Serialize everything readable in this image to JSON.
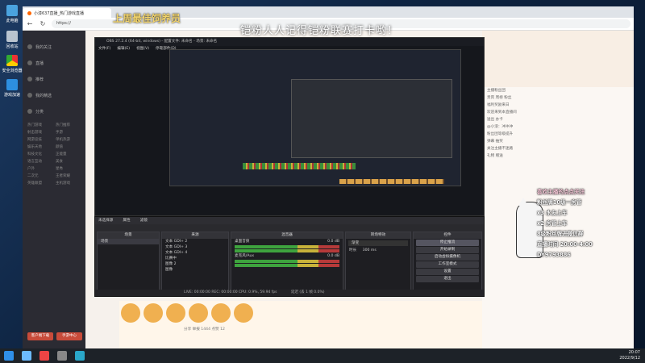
{
  "desktop": {
    "icons": [
      "此电脑",
      "回收站",
      "安全浏览器",
      "游戏加速"
    ]
  },
  "browser": {
    "tab_title": "小漆637直播_热门游戏直播",
    "url": "https://"
  },
  "overlay": {
    "banner": "上周最佳饲养员",
    "headline": "铠粉人人记得铠粉联赛打卡哟！"
  },
  "site": {
    "sidebar_items": [
      "我的关注",
      "直播",
      "推荐",
      "我的精选",
      "分类"
    ],
    "sidebar_grid": [
      "热门游戏",
      "热门推荐",
      "射击游戏",
      "手游",
      "网游竞技",
      "单机热游",
      "娱乐天地",
      "颜值",
      "科技文化",
      "正能量",
      "语言互动",
      "美食",
      "户外",
      "星秀",
      "二次元",
      "王者荣耀",
      "英雄联盟",
      "主机游戏"
    ],
    "sidebar_buttons": [
      "客户端下载",
      "手游中心"
    ],
    "chat_lines": [
      "主播粉丝团",
      "贵宾 周榜 粉丝",
      "福利奖励来日",
      "欢迎来到本直播间",
      "送出 办卡",
      "@小漆：冲冲冲",
      "粉丝团等级提升",
      "弹幕 抽奖",
      "关注主播不迷路",
      "礼物 赠送"
    ],
    "bottom_bar": "分享  举报  1444  点赞 12"
  },
  "obs": {
    "menu": [
      "文件(F)",
      "编辑(E)",
      "视图(V)",
      "停靠部件(D)"
    ],
    "title": "OBS 27.2.4 (64-bit, windows) - 配置文件: 未命名 - 场景: 未命名",
    "scene_header": "场景",
    "scene_item": "场景",
    "sources_header": "来源",
    "sources": [
      "文本 GDI+ 2",
      "文本 GDI+ 3",
      "文本 GDI+ 4",
      "比赛中",
      "图像 2",
      "图像"
    ],
    "mixer_header": "混音器",
    "mixer_tracks": [
      "桌面音频",
      "麦克风/Aux"
    ],
    "mixer_levels": [
      "0.0 dB",
      "0.0 dB"
    ],
    "transition_header": "转场特效",
    "transition_mode": "渐变",
    "duration_label": "时长",
    "duration_value": "300 ms",
    "controls_header": "控件",
    "controls": [
      "停止推流",
      "开始录制",
      "启动虚拟摄像机",
      "工作室模式",
      "设置",
      "退出"
    ],
    "no_source": "未选择源",
    "properties_label": "属性",
    "filters_label": "滤镜",
    "status": "LIVE: 00:00:00   REC: 00:00:00   CPU: 0.9%, 59.94 fps",
    "delay_status": "延迟 (丢 1 帧 0.0%)"
  },
  "info_box": {
    "line1": "喜欢主播的点点关注",
    "line2": "粉丝牌10级一房管",
    "line3": "x3 水友上车",
    "line4": "x2 房管上车",
    "line5": "8级粉丝牌进微信群",
    "line6": "直播时间 20:00-4:00",
    "line7": "DY9793886"
  },
  "taskbar": {
    "time": "20:07",
    "date": "2022/9/12"
  },
  "colors": {
    "banner": "#f1d36b",
    "obs_bg": "#2a2a2e",
    "site_bg": "#f6f1ec"
  }
}
